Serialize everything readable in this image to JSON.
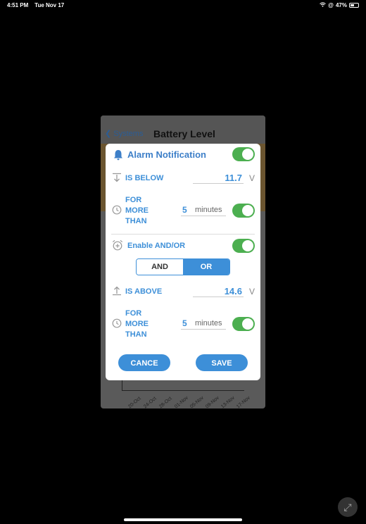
{
  "status_bar": {
    "time": "4:51 PM",
    "date": "Tue Nov 17",
    "battery": "47%"
  },
  "app": {
    "back_label": "Systems",
    "title": "Battery Level",
    "x_ticks": [
      "20-Oct",
      "24-Oct",
      "28-Oct",
      "01-Nov",
      "05-Nov",
      "09-Nov",
      "13-Nov",
      "17-Nov"
    ]
  },
  "dialog": {
    "title": "Alarm Notification",
    "title_icon": "bell-icon",
    "alarm_enabled": true,
    "below": {
      "label": "IS BELOW",
      "icon": "arrow-down-to-line-icon",
      "value": "11.7",
      "unit": "V"
    },
    "below_duration": {
      "label_lines": [
        "FOR",
        "MORE",
        "THAN"
      ],
      "icon": "clock-icon",
      "value": "5",
      "unit": "minutes",
      "enabled": true
    },
    "and_or": {
      "label": "Enable AND/OR",
      "icon": "alarm-add-icon",
      "enabled": true,
      "options": [
        "AND",
        "OR"
      ],
      "selected": "OR"
    },
    "above": {
      "label": "IS ABOVE",
      "icon": "arrow-up-from-line-icon",
      "value": "14.6",
      "unit": "V"
    },
    "above_duration": {
      "label_lines": [
        "FOR",
        "MORE",
        "THAN"
      ],
      "icon": "clock-icon",
      "value": "5",
      "unit": "minutes",
      "enabled": true
    },
    "cancel_label": "CANCE",
    "save_label": "SAVE"
  },
  "colors": {
    "accent": "#3d8fd8",
    "toggle_on": "#4caf50"
  }
}
